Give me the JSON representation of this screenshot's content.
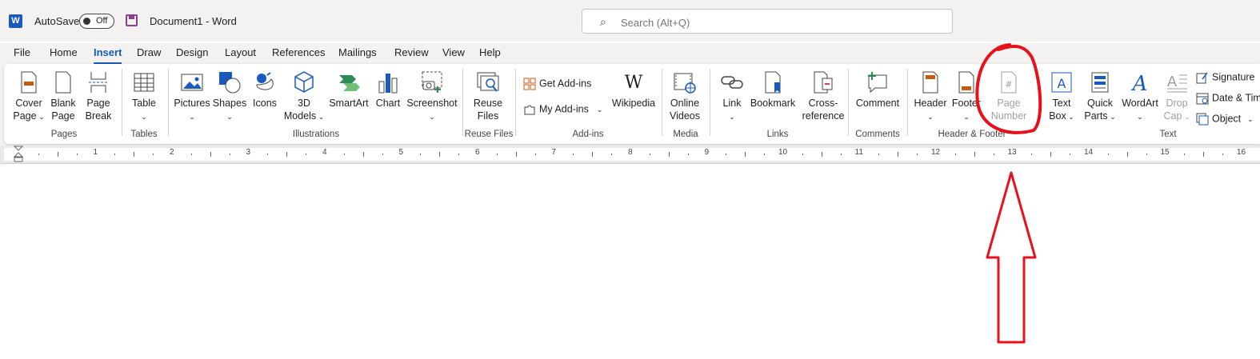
{
  "titlebar": {
    "autosave_label": "AutoSave",
    "toggle_state": "Off",
    "doc_title": "Document1  -  Word",
    "search_placeholder": "Search (Alt+Q)"
  },
  "tabs": [
    "File",
    "Home",
    "Insert",
    "Draw",
    "Design",
    "Layout",
    "References",
    "Mailings",
    "Review",
    "View",
    "Help"
  ],
  "active_tab": "Insert",
  "ribbon": {
    "groups": {
      "pages": "Pages",
      "tables": "Tables",
      "illustrations": "Illustrations",
      "reuse_files": "Reuse Files",
      "add_ins": "Add-ins",
      "media": "Media",
      "links": "Links",
      "comments": "Comments",
      "header_footer": "Header & Footer",
      "text": "Text"
    },
    "commands": {
      "cover_page": [
        "Cover",
        "Page"
      ],
      "blank_page": [
        "Blank",
        "Page"
      ],
      "page_break": [
        "Page",
        "Break"
      ],
      "table": "Table",
      "pictures": "Pictures",
      "shapes": "Shapes",
      "icons": "Icons",
      "models_3d": [
        "3D",
        "Models"
      ],
      "smartart": "SmartArt",
      "chart": "Chart",
      "screenshot": "Screenshot",
      "reuse_files": [
        "Reuse",
        "Files"
      ],
      "get_add_ins": "Get Add-ins",
      "my_add_ins": "My Add-ins",
      "wikipedia": "Wikipedia",
      "online_videos": [
        "Online",
        "Videos"
      ],
      "link": "Link",
      "bookmark": "Bookmark",
      "cross_reference": [
        "Cross-",
        "reference"
      ],
      "comment": "Comment",
      "header": "Header",
      "footer": "Footer",
      "page_number": [
        "Page",
        "Number"
      ],
      "text_box": [
        "Text",
        "Box"
      ],
      "quick_parts": [
        "Quick",
        "Parts"
      ],
      "wordart": "WordArt",
      "drop_cap": [
        "Drop",
        "Cap"
      ],
      "signature": "Signature",
      "date_time": "Date & Tim",
      "object": "Object"
    }
  },
  "ruler": {
    "numbers": [
      "1",
      "2",
      "3",
      "4",
      "5",
      "6",
      "7",
      "8",
      "9",
      "10",
      "11",
      "12",
      "13",
      "14",
      "15",
      "16"
    ]
  },
  "colors": {
    "accent": "#185abd",
    "annotation": "#e8101a",
    "chrome": "#f3f2f1"
  }
}
